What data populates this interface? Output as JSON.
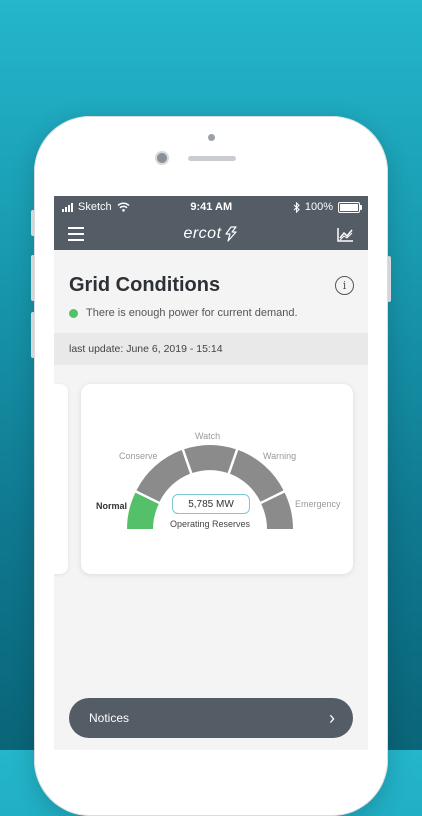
{
  "status_bar": {
    "carrier": "Sketch",
    "time": "9:41 AM",
    "battery": "100%"
  },
  "app_bar": {
    "logo_text": "ercot"
  },
  "header": {
    "title": "Grid Conditions",
    "status_text": "There is enough power for current demand.",
    "status_color": "#54c06a"
  },
  "update": {
    "text": "last update: June 6, 2019 - 15:14"
  },
  "gauge": {
    "labels": {
      "normal": "Normal",
      "conserve": "Conserve",
      "watch": "Watch",
      "warning": "Warning",
      "emergency": "Emergency"
    },
    "value_text": "5,785 MW",
    "caption": "Operating Reserves",
    "active_color": "#54c06a",
    "inactive_color": "#8b8b8b"
  },
  "notices": {
    "label": "Notices"
  },
  "colors": {
    "accent": "#545c66",
    "background_top": "#24b6cc",
    "background_bottom": "#0a6578"
  }
}
